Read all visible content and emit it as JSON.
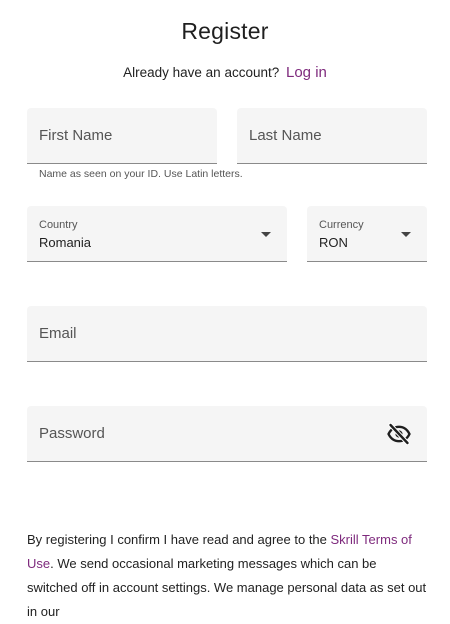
{
  "header": {
    "title": "Register",
    "login_prompt": "Already have an account?",
    "login_link": "Log in"
  },
  "form": {
    "first_name": {
      "placeholder": "First Name",
      "value": ""
    },
    "last_name": {
      "placeholder": "Last Name",
      "value": ""
    },
    "name_helper": "Name as seen on your ID. Use Latin letters.",
    "country": {
      "label": "Country",
      "value": "Romania",
      "icon": "chevron-down-icon"
    },
    "currency": {
      "label": "Currency",
      "value": "RON",
      "icon": "chevron-down-icon"
    },
    "email": {
      "placeholder": "Email",
      "value": ""
    },
    "password": {
      "placeholder": "Password",
      "value": "",
      "icon": "eye-off-icon"
    }
  },
  "legal": {
    "text_before": "By registering I confirm I have read and agree to the ",
    "terms_link": "Skrill Terms of Use",
    "text_after": ". We send occasional marketing messages which can be switched off in account settings. We manage personal data as set out in our"
  },
  "colors": {
    "link": "#7e2a7d",
    "field_background": "#f5f5f5",
    "field_border": "#8a8a8a"
  }
}
